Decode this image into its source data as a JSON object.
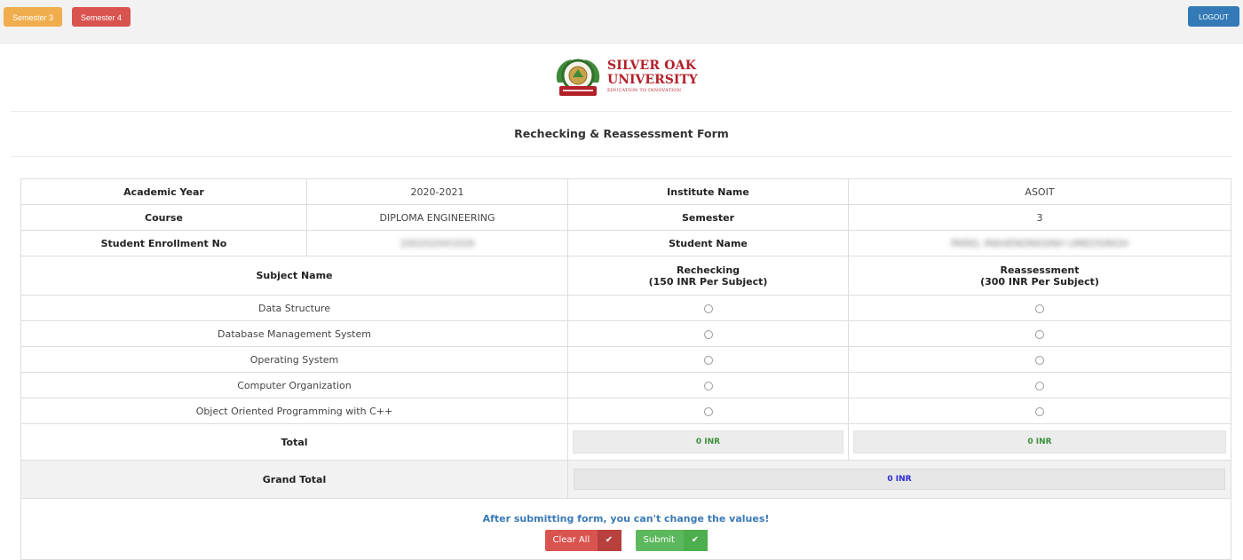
{
  "topbar": {
    "semester3_label": "Semester 3",
    "semester4_label": "Semester 4",
    "logout_label": "LOGOUT"
  },
  "logo": {
    "line1": "SILVER OAK",
    "line2": "UNIVERSITY",
    "tagline": "EDUCATION TO INNOVATION"
  },
  "form": {
    "title": "Rechecking & Reassessment Form",
    "academic_year_label": "Academic Year",
    "academic_year_value": "2020-2021",
    "institute_label": "Institute Name",
    "institute_value": "ASOIT",
    "course_label": "Course",
    "course_value": "DIPLOMA ENGINEERING",
    "semester_label": "Semester",
    "semester_value": "3",
    "enrollment_label": "Student Enrollment No",
    "enrollment_value": "200202041026",
    "student_name_label": "Student Name",
    "student_name_value": "PAREL MAHENDRASINH UMEDSINGH",
    "subject_header": "Subject Name",
    "rechecking_header": "Rechecking",
    "rechecking_fee": "(150 INR Per Subject)",
    "reassessment_header": "Reassessment",
    "reassessment_fee": "(300 INR Per Subject)",
    "subjects": [
      "Data Structure",
      "Database Management System",
      "Operating System",
      "Computer Organization",
      "Object Oriented Programming with C++"
    ],
    "total_label": "Total",
    "rechecking_total": "0 INR",
    "reassessment_total": "0 INR",
    "grand_total_label": "Grand Total",
    "grand_total_value": "0 INR",
    "note": "After submitting form, you can't change the values!",
    "clear_label": "Clear All",
    "submit_label": "Submit"
  }
}
